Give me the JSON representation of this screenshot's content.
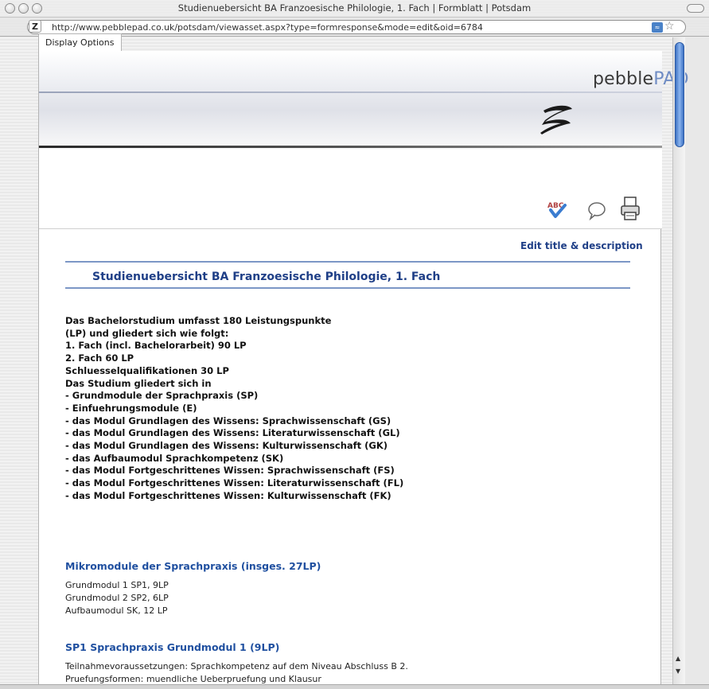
{
  "window": {
    "title": "Studienuebersicht BA Franzoesische Philologie, 1. Fach | Formblatt | Potsdam"
  },
  "toolbar": {
    "url": "http://www.pebblepad.co.uk/potsdam/viewasset.aspx?type=formresponse&mode=edit&oid=6784",
    "favicon_glyph": "Z"
  },
  "tabs": {
    "display_options": "Display Options"
  },
  "logo": {
    "word_a": "pebble",
    "word_b": "PAD"
  },
  "tools": {
    "spellcheck_icon": "spellcheck-icon",
    "comment_icon": "comment-bubble-icon",
    "print_icon": "printer-icon",
    "spellcheck_text": "ABC"
  },
  "actions": {
    "edit_title": "Edit title & description"
  },
  "document": {
    "title": "Studienuebersicht BA Franzoesische Philologie, 1. Fach",
    "intro_lines": [
      "Das Bachelorstudium umfasst 180 Leistungspunkte",
      "(LP) und gliedert sich wie folgt:",
      "1. Fach (incl. Bachelorarbeit) 90 LP",
      "2. Fach 60 LP",
      "Schluesselqualifikationen 30 LP",
      "Das Studium gliedert sich in",
      "- Grundmodule der Sprachpraxis (SP)",
      "- Einfuehrungsmodule (E)",
      "- das Modul Grundlagen des Wissens: Sprachwissenschaft (GS)",
      "- das Modul Grundlagen des Wissens: Literaturwissenschaft (GL)",
      "- das Modul Grundlagen des Wissens: Kulturwissenschaft (GK)",
      "- das Aufbaumodul Sprachkompetenz (SK)",
      "- das Modul Fortgeschrittenes Wissen: Sprachwissenschaft (FS)",
      "- das Modul Fortgeschrittenes Wissen: Literaturwissenschaft (FL)",
      "- das Modul Fortgeschrittenes Wissen: Kulturwissenschaft (FK)"
    ],
    "section1": {
      "heading": "Mikromodule der Sprachpraxis (insges. 27LP)",
      "lines": [
        "Grundmodul 1 SP1, 9LP",
        "Grundmodul 2 SP2, 6LP",
        "Aufbaumodul SK, 12 LP"
      ]
    },
    "section2": {
      "heading": "SP1 Sprachpraxis Grundmodul 1 (9LP)",
      "lines": [
        "Teilnahmevoraussetzungen: Sprachkompetenz auf dem Niveau Abschluss B 2.",
        "Pruefungsformen: muendliche Ueberpruefung und Klausur"
      ]
    }
  },
  "colors": {
    "accent_blue": "#1f3f87",
    "heading_blue": "#2050a0",
    "rule_blue": "#7c97c6",
    "scroll_blue": "#3d72c4"
  }
}
